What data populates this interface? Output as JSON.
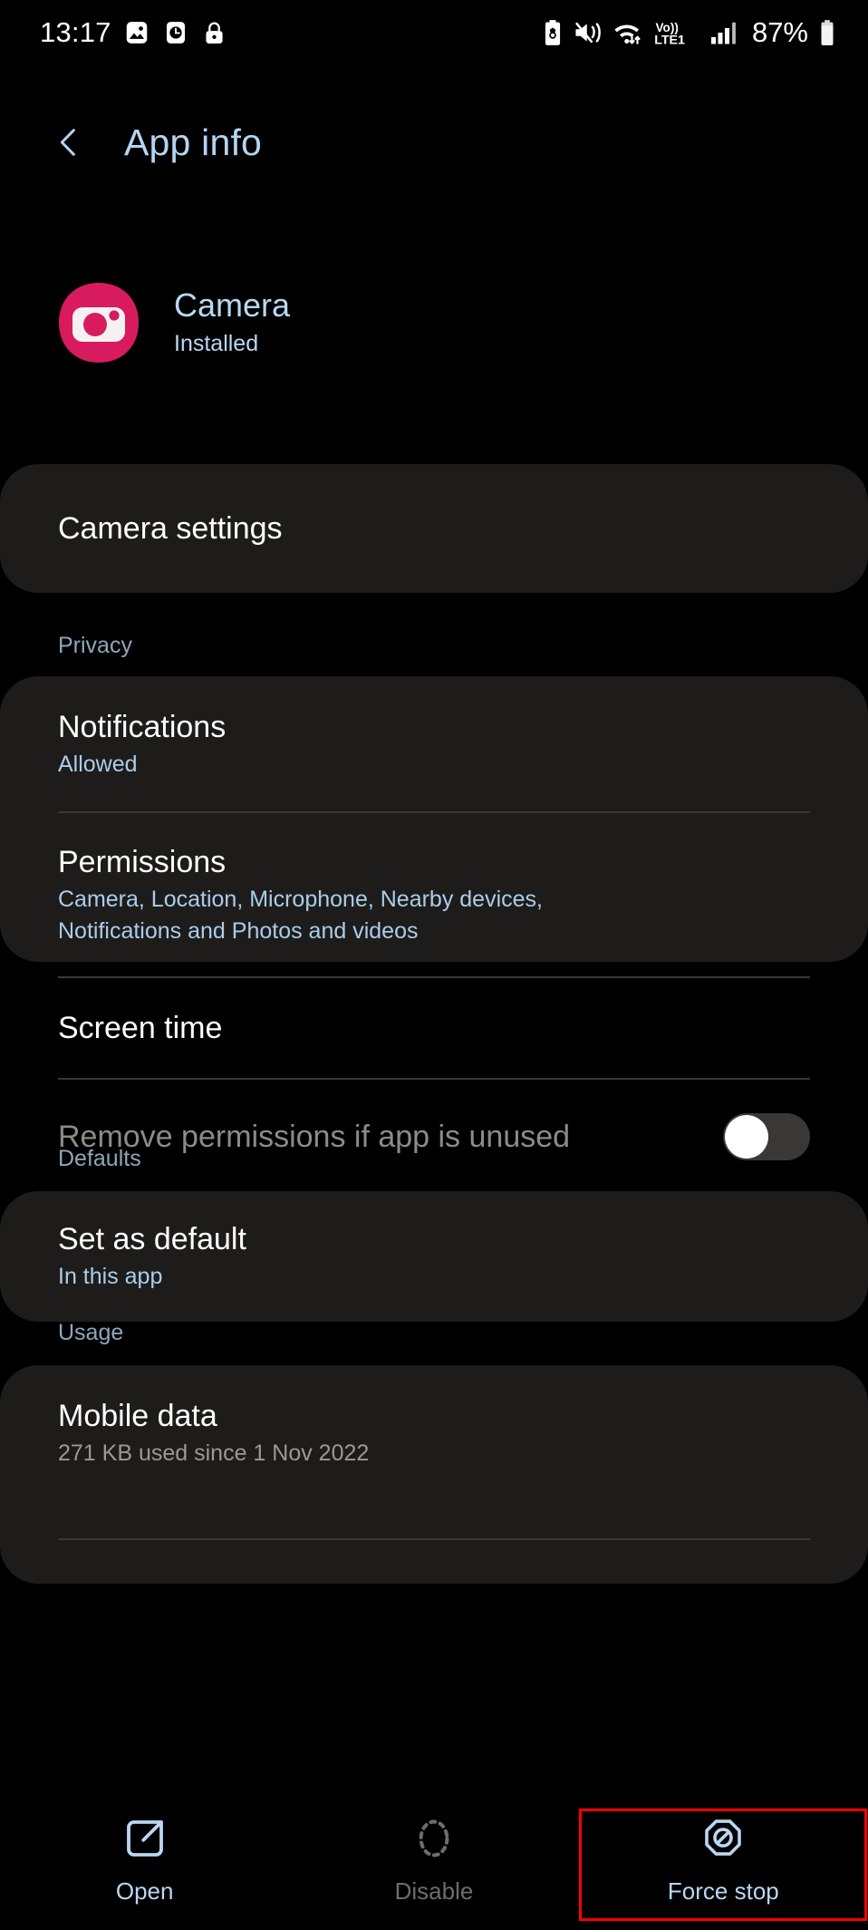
{
  "status_bar": {
    "time": "13:17",
    "left_icons": [
      "photo-icon",
      "clock-icon",
      "lock-icon"
    ],
    "right_icons": [
      "battery-saver-icon",
      "mute-vibrate-icon",
      "wifi-data-icon",
      "volte1-icon",
      "signal-bars-icon"
    ],
    "network_label": "Vo)) LTE1",
    "battery_percent": "87%"
  },
  "header": {
    "back_icon": "chevron-left-icon",
    "title": "App info"
  },
  "app": {
    "icon": "camera-app-icon",
    "name": "Camera",
    "status": "Installed"
  },
  "settings_card": {
    "label": "Camera settings"
  },
  "sections": [
    {
      "label": "Privacy",
      "rows": [
        {
          "title": "Notifications",
          "subtitle": "Allowed",
          "subtitle_style": "blue",
          "control": "none"
        },
        {
          "title": "Permissions",
          "subtitle": "Camera, Location, Microphone, Nearby devices, Notifications and Photos and videos",
          "subtitle_style": "blue",
          "control": "none"
        },
        {
          "title": "Screen time",
          "subtitle": "",
          "subtitle_style": "none",
          "control": "none"
        },
        {
          "title": "Remove permissions if app is unused",
          "subtitle": "",
          "subtitle_style": "none",
          "control": "toggle",
          "toggle_on": false,
          "disabled": true
        }
      ]
    },
    {
      "label": "Defaults",
      "rows": [
        {
          "title": "Set as default",
          "subtitle": "In this app",
          "subtitle_style": "blue",
          "control": "none"
        }
      ]
    },
    {
      "label": "Usage",
      "rows": [
        {
          "title": "Mobile data",
          "subtitle": "271 KB used since 1 Nov 2022",
          "subtitle_style": "gray",
          "control": "none"
        }
      ]
    }
  ],
  "bottom_bar": {
    "buttons": [
      {
        "label": "Open",
        "icon": "open-external-icon",
        "disabled": false,
        "highlighted": false
      },
      {
        "label": "Disable",
        "icon": "disable-dashed-icon",
        "disabled": true,
        "highlighted": false
      },
      {
        "label": "Force stop",
        "icon": "force-stop-octagon-icon",
        "disabled": false,
        "highlighted": true
      }
    ]
  },
  "colors": {
    "background": "#000000",
    "card": "#1e1c1a",
    "accent_blue": "#b9d7f2",
    "section_label": "#8fa6bb",
    "divider": "#3a3836",
    "app_icon_pink": "#d81b5f",
    "highlight_red": "#ff0000"
  }
}
